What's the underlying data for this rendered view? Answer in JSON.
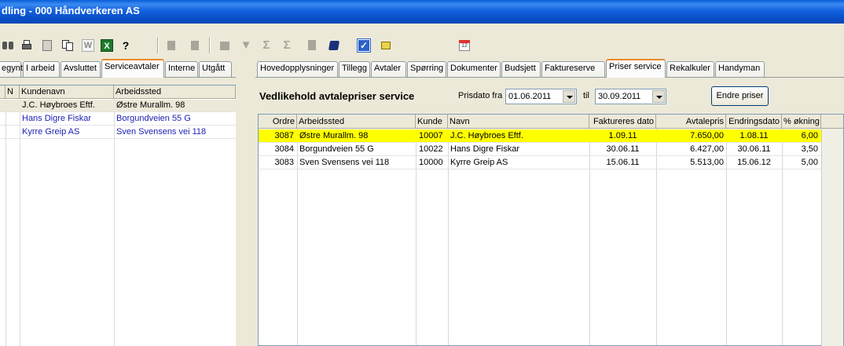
{
  "window": {
    "title": "dling - 000 Håndverkeren AS"
  },
  "toolbar": {
    "icons": [
      "binoculars-icon",
      "print-icon",
      "calculator-icon",
      "copy-icon",
      "word-icon",
      "excel-icon",
      "help-icon",
      "disabled-icon",
      "disabled-icon",
      "disabled-icon",
      "filter-icon",
      "sum-icon",
      "sum-sub-icon",
      "document-icon",
      "book-icon",
      "checkbox-icon",
      "notes-icon",
      "calendar-icon"
    ],
    "word_glyph": "W",
    "excel_glyph": "X",
    "help_glyph": "?",
    "sigma_glyph": "Σ",
    "calendar_day": "12"
  },
  "left_tabs": [
    {
      "label": "egynt",
      "active": false
    },
    {
      "label": "I arbeid",
      "active": false
    },
    {
      "label": "Avsluttet",
      "active": false
    },
    {
      "label": "Serviceavtaler",
      "active": true
    },
    {
      "label": "Interne",
      "active": false
    },
    {
      "label": "Utgått",
      "active": false
    }
  ],
  "right_tabs": [
    {
      "label": "Hovedopplysninger",
      "active": false
    },
    {
      "label": "Tillegg",
      "active": false
    },
    {
      "label": "Avtaler",
      "active": false
    },
    {
      "label": "Spørring",
      "active": false
    },
    {
      "label": "Dokumenter",
      "active": false
    },
    {
      "label": "Budsjett",
      "active": false
    },
    {
      "label": "Faktureserve",
      "active": false
    },
    {
      "label": "Priser service",
      "active": true
    },
    {
      "label": "Rekalkuler",
      "active": false
    },
    {
      "label": "Handyman",
      "active": false
    }
  ],
  "left_grid": {
    "columns": [
      "",
      "N",
      "Kundenavn",
      "Arbeidssted"
    ],
    "rows": [
      {
        "kundenavn": "J.C. Høybroes Eftf.",
        "arbeidssted": "Østre Murallm. 98",
        "selected": true
      },
      {
        "kundenavn": "Hans Digre Fiskar",
        "arbeidssted": "Borgundveien 55 G",
        "selected": false
      },
      {
        "kundenavn": "Kyrre Greip AS",
        "arbeidssted": "Sven Svensens vei 118",
        "selected": false
      }
    ]
  },
  "panel": {
    "title": "Vedlikehold avtalepriser service",
    "from_label": "Prisdato fra",
    "from_value": "01.06.2011",
    "to_label": "til",
    "to_value": "30.09.2011",
    "button_label": "Endre priser"
  },
  "price_grid": {
    "columns": [
      "Ordre",
      "Arbeidssted",
      "Kunde",
      "Navn",
      "Faktureres dato",
      "Avtalepris",
      "Endringsdato",
      "% økning"
    ],
    "rows": [
      {
        "ordre": "3087",
        "arbeidssted": "Østre Murallm. 98",
        "kunde": "10007",
        "navn": "J.C. Høybroes Eftf.",
        "faktureres": "1.09.11",
        "avtalepris": "7.650,00",
        "endringsdato": "1.08.11",
        "okning": "6,00",
        "highlight": true
      },
      {
        "ordre": "3084",
        "arbeidssted": "Borgundveien 55 G",
        "kunde": "10022",
        "navn": "Hans Digre Fiskar",
        "faktureres": "30.06.11",
        "avtalepris": "6.427,00",
        "endringsdato": "30.06.11",
        "okning": "3,50",
        "highlight": false
      },
      {
        "ordre": "3083",
        "arbeidssted": "Sven Svensens vei 118",
        "kunde": "10000",
        "navn": "Kyrre Greip AS",
        "faktureres": "15.06.11",
        "avtalepris": "5.513,00",
        "endringsdato": "15.06.12",
        "okning": "5,00",
        "highlight": false
      }
    ]
  },
  "colors": {
    "highlight": "#ffff00",
    "link_text": "#1e22b4",
    "titlebar": "#0a5fd8"
  }
}
